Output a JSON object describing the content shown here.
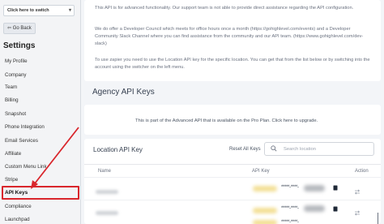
{
  "sidebar": {
    "switch_label": "Click here to switch",
    "go_back_label": "Go Back",
    "settings_title": "Settings",
    "items": [
      "My Profile",
      "Company",
      "Team",
      "Billing",
      "Snapshot",
      "Phone Integration",
      "Email Services",
      "Affiliate",
      "Custom Menu Link",
      "Stripe",
      "API Keys",
      "Compliance",
      "Launchpad"
    ]
  },
  "info": {
    "p1": "This API is for advanced functionality. Our support team is not able to provide direct assistance regarding the API configuration.",
    "p2": "We do offer a Developer Council which meets for office hours once a month (https://gohighlevel.com/events) and a Developer Community Slack Channel where you can find assistance from the community and our API team. (https://www.gohighlevel.com/dev-slack)",
    "p3": "To use zapier you need to use the Location API key for the specific location. You can get that from the list below or by switching into the account using the switcher on the left menu."
  },
  "agency": {
    "title": "Agency API Keys",
    "message": "This is part of the Advanced API that is available on the Pro Plan. Click here to upgrade."
  },
  "location": {
    "title": "Location API Key",
    "reset_all": "Reset All Keys",
    "search_placeholder": "Search location",
    "columns": [
      "Name",
      "API Key",
      "Action"
    ],
    "rows": [
      {
        "masked_key": "*****-****-"
      },
      {
        "masked_key": "*****-****-"
      },
      {
        "masked_key": "*****-****-"
      }
    ]
  },
  "colors": {
    "highlight": "#d9262c",
    "key_highlight": "#f3df94"
  }
}
